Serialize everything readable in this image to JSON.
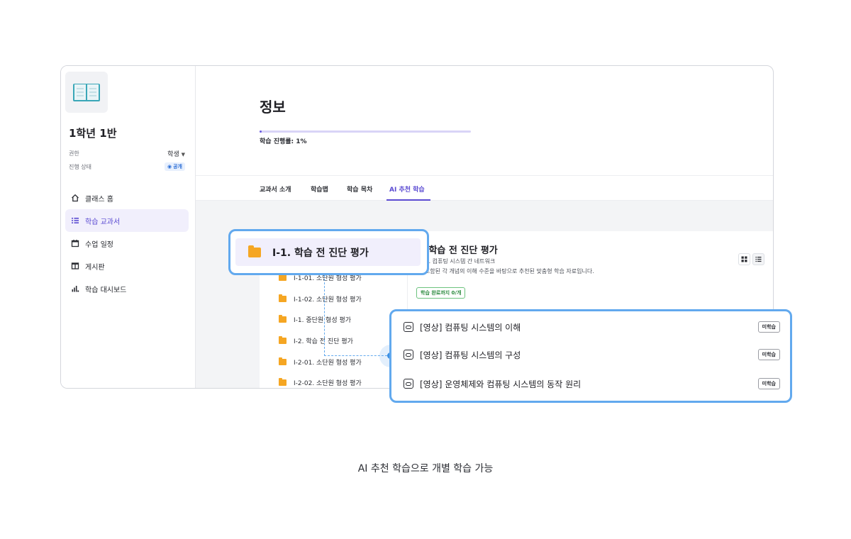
{
  "sidebar": {
    "class_name": "1학년 1반",
    "meta": [
      {
        "label": "권한",
        "value": "학생"
      },
      {
        "label": "진행 상태",
        "value": "공개"
      }
    ],
    "nav": [
      {
        "label": "클래스 홈",
        "icon": "home-icon"
      },
      {
        "label": "학습 교과서",
        "icon": "list-icon",
        "active": true
      },
      {
        "label": "수업 일정",
        "icon": "calendar-icon"
      },
      {
        "label": "게시판",
        "icon": "board-icon"
      },
      {
        "label": "학습 대시보드",
        "icon": "bar-chart-icon"
      }
    ]
  },
  "main": {
    "title": "정보",
    "progress": {
      "label": "학습 진행률: 1%",
      "percent": 1
    },
    "tabs": [
      {
        "label": "교과서 소개"
      },
      {
        "label": "학습맵"
      },
      {
        "label": "학습 목차"
      },
      {
        "label": "AI 추천 학습",
        "active": true
      }
    ],
    "folders": [
      "I-1-01. 소단원 형성 평가",
      "I-1-02. 소단원 형성 평가",
      "I-1. 중단원 형성 평가",
      "I-2. 학습 전 진단 평가",
      "I-2-01. 소단원 형성 평가",
      "I-2-02. 소단원 형성 평가"
    ],
    "detail": {
      "title": ". 학습 전 진단 평가",
      "subtitle": ": I-1. 컴퓨팅 시스템 간 네트워크",
      "description": "에 포함된 각 개념의 이해 수준을 바탕으로 추천된 맞춤형 학습 자료입니다.",
      "completion": "학습 완료까지 0/개"
    }
  },
  "callout": {
    "folder_label": "I-1. 학습 전 진단 평가",
    "lessons": [
      {
        "title": "[영상] 컴퓨팅 시스템의 이해",
        "status": "미학습"
      },
      {
        "title": "[영상] 컴퓨팅 시스템의 구성",
        "status": "미학습"
      },
      {
        "title": "[영상] 운영체제와 컴퓨팅 시스템의 동작 원리",
        "status": "미학습"
      }
    ]
  },
  "caption": "AI 추천 학습으로 개별 학습 가능",
  "colors": {
    "accent": "#5b4bd2",
    "callout_border": "#62a9ee",
    "folder": "#f5a623"
  }
}
